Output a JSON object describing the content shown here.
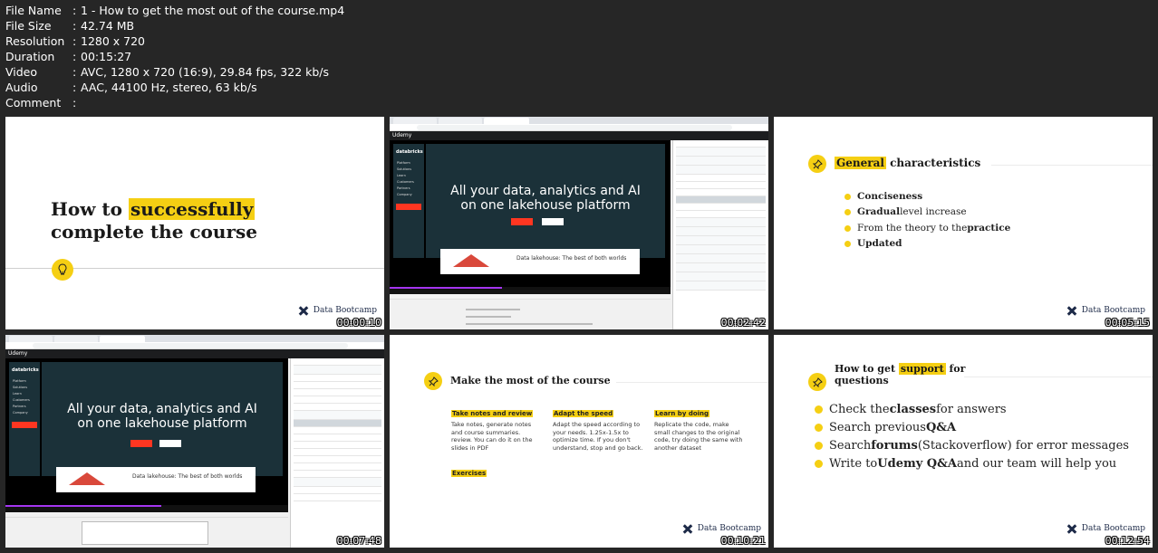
{
  "meta": [
    {
      "key": "File Name",
      "value": "1 - How to get the most out of the course.mp4"
    },
    {
      "key": "File Size",
      "value": "42.74 MB"
    },
    {
      "key": "Resolution",
      "value": "1280 x 720"
    },
    {
      "key": "Duration",
      "value": "00:15:27"
    },
    {
      "key": "Video",
      "value": "AVC, 1280 x 720 (16:9), 29.84 fps, 322 kb/s"
    },
    {
      "key": "Audio",
      "value": "AAC, 44100 Hz, stereo, 63 kb/s"
    },
    {
      "key": "Comment",
      "value": ""
    }
  ],
  "brand": "Data Bootcamp",
  "icons": {
    "bulb": "lightbulb-icon",
    "pin": "pushpin-icon",
    "logo": "data-bootcamp-logo-icon"
  },
  "colors": {
    "accent": "#f5cf13",
    "background": "#262626",
    "databricks": "#1b3139",
    "databricks_red": "#ff3621",
    "udemy_purple": "#a435f0"
  },
  "thumbs": [
    {
      "timestamp": "00:00:10",
      "title_pre": "How to ",
      "title_hl": "successfully",
      "title_line2": "complete the course"
    },
    {
      "timestamp": "00:02:42",
      "udemy": "Udemy",
      "databricks": "databricks",
      "menu": [
        "Platform",
        "Solutions",
        "Learn",
        "Customers",
        "Partners",
        "Company"
      ],
      "hero_l1": "All your data, analytics and AI",
      "hero_l2": "on one lakehouse platform",
      "lake": "Data lakehouse: The best of both worlds"
    },
    {
      "timestamp": "00:05:15",
      "h_hl": "General",
      "h_rest": " characteristics",
      "bullets": [
        {
          "pre": "",
          "bold": "Conciseness",
          "post": ""
        },
        {
          "pre": "",
          "bold": "Gradual",
          "post": " level increase"
        },
        {
          "pre": "From the theory to the ",
          "bold": "practice",
          "post": ""
        },
        {
          "pre": "",
          "bold": "Updated",
          "post": ""
        }
      ]
    },
    {
      "timestamp": "00:07:48",
      "udemy": "Udemy",
      "databricks": "databricks",
      "menu": [
        "Platform",
        "Solutions",
        "Learn",
        "Customers",
        "Partners",
        "Company"
      ],
      "hero_l1": "All your data, analytics and AI",
      "hero_l2": "on one lakehouse platform",
      "lake": "Data lakehouse: The best of both worlds"
    },
    {
      "timestamp": "00:10:21",
      "heading": "Make the most of the course",
      "cols": [
        {
          "h": "Take notes and review",
          "b": "Take notes, generate notes and course summaries. review. You can do it on the slides in PDF"
        },
        {
          "h": "Adapt the speed",
          "b": "Adapt the speed according to your needs. 1.25x-1.5x to optimize time. If you don't understand, stop and go back."
        },
        {
          "h": "Learn by doing",
          "b": "Replicate the code, make small changes to the original code, try doing the same with another dataset"
        }
      ],
      "exercises": "Exercises"
    },
    {
      "timestamp": "00:12:54",
      "h_pre": "How to get ",
      "h_hl": "support",
      "h_post": " for",
      "h_line2": "questions",
      "bullets": [
        {
          "pre": "Check the ",
          "bold": "classes",
          "post": " for answers"
        },
        {
          "pre": "Search previous ",
          "bold": "Q&A",
          "post": ""
        },
        {
          "pre": "Search ",
          "bold": "forums",
          "post": " (Stackoverflow) for error messages"
        },
        {
          "pre": "Write to ",
          "bold": "Udemy Q&A",
          "post": " and our team will help you"
        }
      ]
    }
  ]
}
